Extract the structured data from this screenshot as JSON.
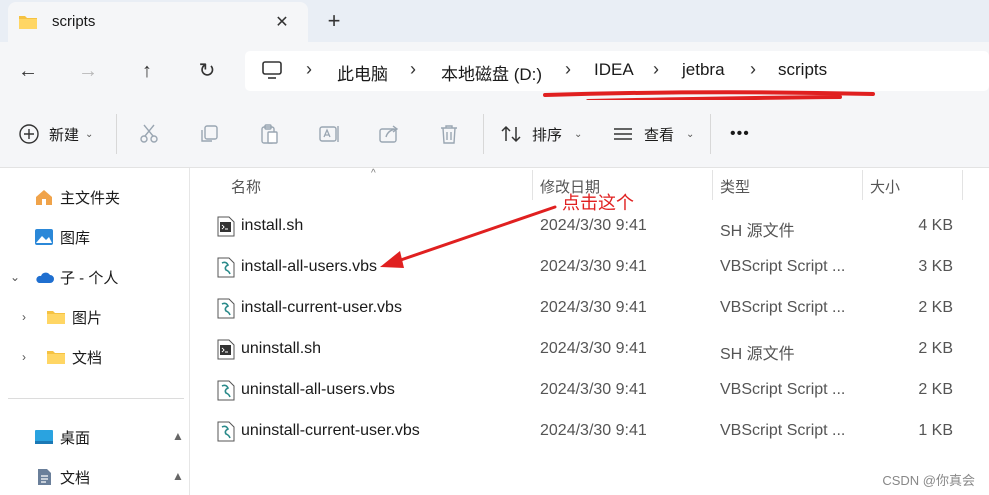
{
  "tab": {
    "title": "scripts",
    "close_glyph": "✕",
    "new_tab_glyph": "+"
  },
  "nav": {
    "back_glyph": "←",
    "forward_glyph": "→",
    "up_glyph": "↑",
    "refresh_glyph": "↻",
    "breadcrumbs": [
      "此电脑",
      "本地磁盘 (D:)",
      "IDEA",
      "jetbra",
      "scripts"
    ],
    "separator": "›"
  },
  "toolbar": {
    "new_label": "新建",
    "sort_label": "排序",
    "view_label": "查看",
    "more_label": "•••",
    "chevron": "⌄"
  },
  "sidebar": {
    "items": [
      {
        "label": "主文件夹",
        "icon": "home-icon"
      },
      {
        "label": "图库",
        "icon": "gallery-icon"
      },
      {
        "label": "子 - 个人",
        "icon": "cloud-icon"
      },
      {
        "label": "图片",
        "icon": "folder-icon"
      },
      {
        "label": "文档",
        "icon": "folder-icon"
      },
      {
        "label": "桌面",
        "icon": "desktop-icon"
      },
      {
        "label": "文档",
        "icon": "document-icon"
      }
    ],
    "expand_glyph": "›",
    "expanded_glyph": "⌄",
    "pin_glyph": "📌"
  },
  "columns": {
    "name": "名称",
    "date": "修改日期",
    "type": "类型",
    "size": "大小",
    "sort_caret": "^"
  },
  "files": [
    {
      "name": "install.sh",
      "date": "2024/3/30 9:41",
      "type": "SH 源文件",
      "size": "4 KB",
      "kind": "sh"
    },
    {
      "name": "install-all-users.vbs",
      "date": "2024/3/30 9:41",
      "type": "VBScript Script ...",
      "size": "3 KB",
      "kind": "vbs"
    },
    {
      "name": "install-current-user.vbs",
      "date": "2024/3/30 9:41",
      "type": "VBScript Script ...",
      "size": "2 KB",
      "kind": "vbs"
    },
    {
      "name": "uninstall.sh",
      "date": "2024/3/30 9:41",
      "type": "SH 源文件",
      "size": "2 KB",
      "kind": "sh"
    },
    {
      "name": "uninstall-all-users.vbs",
      "date": "2024/3/30 9:41",
      "type": "VBScript Script ...",
      "size": "2 KB",
      "kind": "vbs"
    },
    {
      "name": "uninstall-current-user.vbs",
      "date": "2024/3/30 9:41",
      "type": "VBScript Script ...",
      "size": "1 KB",
      "kind": "vbs"
    }
  ],
  "annotation": {
    "text": "点击这个",
    "color": "#e02020"
  },
  "watermark": "CSDN @你真会",
  "colors": {
    "accent": "#0067c0",
    "folder": "#f5c242",
    "annotation": "#e02020"
  }
}
